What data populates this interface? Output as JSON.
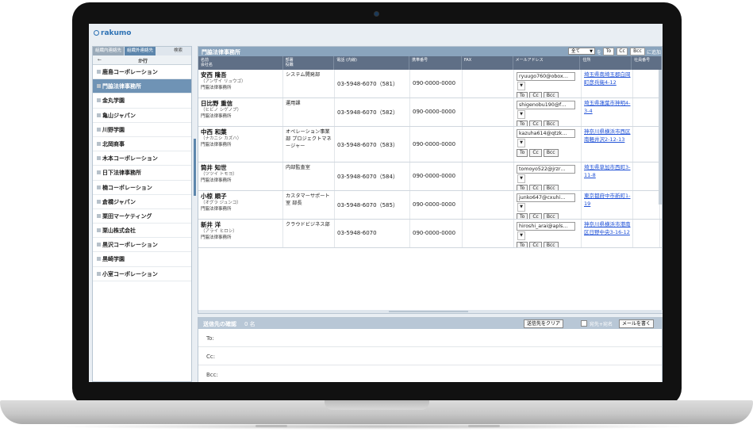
{
  "app": {
    "logo": "rakumo"
  },
  "sidebar": {
    "tabs": [
      "組織内連絡先",
      "組織外連絡先",
      "検索"
    ],
    "kana_back": "←",
    "kana_label": "か行",
    "companies": [
      "鹿島コーポレーション",
      "門脇法律事務所",
      "金丸学園",
      "亀山ジャパン",
      "川野学園",
      "北岡商事",
      "木本コーポレーション",
      "日下法律事務所",
      "楠コーポレーション",
      "倉橋ジャパン",
      "栗田マーケティング",
      "栗山株式会社",
      "黒沢コーポレーション",
      "黒崎学園",
      "小室コーポレーション"
    ],
    "selected_index": 1
  },
  "main": {
    "title": "門脇法律事務所",
    "filter": "全て",
    "wo": "を",
    "buttons": [
      "To",
      "Cc",
      "Bcc"
    ],
    "add_label": "に追加",
    "columns": {
      "name": "名前",
      "company": "会社名",
      "dept": "部署",
      "title": "役職",
      "phone": "電話 (内線)",
      "mobile": "携帯番号",
      "fax": "FAX",
      "email": "メールアドレス",
      "address": "住所",
      "emp": "社員番号"
    },
    "rows": [
      {
        "name": "安西 隆吾",
        "kana": "（アンザイ リュウゴ）",
        "company": "門脇法律事務所",
        "dept": "システム開発部",
        "phone": "03-5948-6070（581）",
        "mobile": "090-0000-0000",
        "email": "ryuugo760@obox…",
        "address": "埼玉県南埼玉郡白岡町彦兵衛4-12"
      },
      {
        "name": "日比野 重信",
        "kana": "（ヒビノ シゲノブ）",
        "company": "門脇法律事務所",
        "dept": "運用課",
        "phone": "03-5948-6070（582）",
        "mobile": "090-0000-0000",
        "email": "shigenobu190@f…",
        "address": "埼玉県蓮葉市神明4-3-4"
      },
      {
        "name": "中西 和葉",
        "kana": "（ナカニシ カズハ）",
        "company": "門脇法律事務所",
        "dept": "オペレーション事業部 プロジェクトマネージャー",
        "phone": "03-5948-6070（583）",
        "mobile": "090-0000-0000",
        "email": "kazuha614@qtzk…",
        "address": "神奈川県横浜市西区南軽井沢2-12-13"
      },
      {
        "name": "筒井 知世",
        "kana": "（ツツイ トモヨ）",
        "company": "門脇法律事務所",
        "dept": "内部監査室",
        "phone": "03-5948-6070（584）",
        "mobile": "090-0000-0000",
        "email": "tomoyo522@jrzr…",
        "address": "埼玉県草加市西町3-11-8"
      },
      {
        "name": "小椋 順子",
        "kana": "（オグラ ジュンコ）",
        "company": "門脇法律事務所",
        "dept": "カスタマーサポート室 部長",
        "phone": "03-5948-6070（585）",
        "mobile": "090-0000-0000",
        "email": "junko647@cxuhi…",
        "address": "東京都府中市新町1-19"
      },
      {
        "name": "新井 洋",
        "kana": "（アライ ヒロシ）",
        "company": "門脇法律事務所",
        "dept": "クラウドビジネス部",
        "phone": "03-5948-6070",
        "mobile": "090-0000-0000",
        "email": "hiroshi_arai@apls…",
        "address": "神奈川県横浜市港南区日野中央3-16-12"
      }
    ]
  },
  "bottom": {
    "title": "送信先の確認",
    "count": "0 名",
    "clear": "送信先をクリア",
    "check_label": "宛先+宛名",
    "mail_button": "メールを書く",
    "fields": [
      "To:",
      "Cc:",
      "Bcc:"
    ]
  }
}
